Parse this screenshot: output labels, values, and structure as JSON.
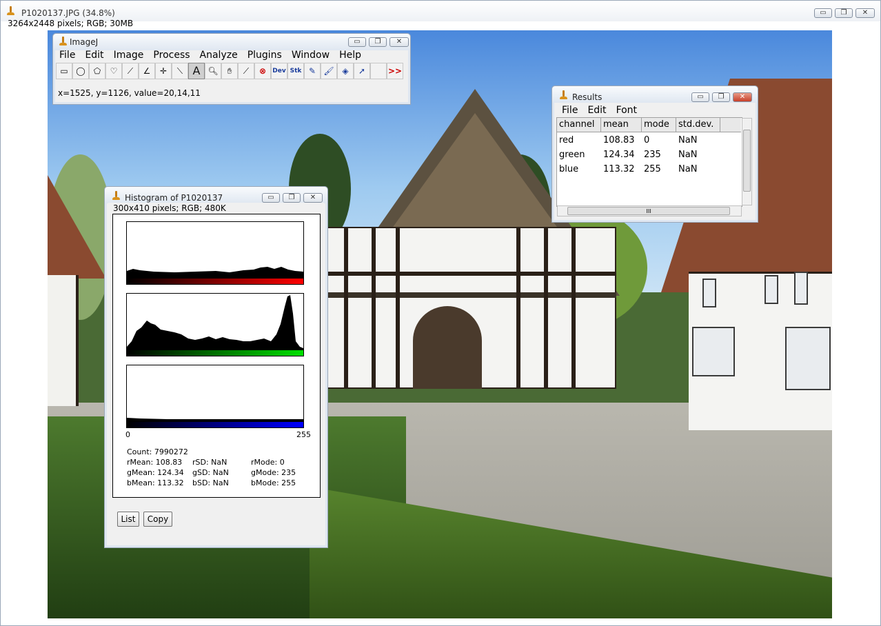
{
  "main_window": {
    "title": "P1020137.JPG (34.8%)",
    "info": "3264x2448 pixels; RGB; 30MB",
    "controls": {
      "minimize": "▭",
      "maximize": "❐",
      "close": "✕"
    }
  },
  "imagej": {
    "title": "ImageJ",
    "menu": [
      "File",
      "Edit",
      "Image",
      "Process",
      "Analyze",
      "Plugins",
      "Window",
      "Help"
    ],
    "tools": [
      {
        "name": "rectangle-tool-icon",
        "glyph": "▭"
      },
      {
        "name": "oval-tool-icon",
        "glyph": "◯"
      },
      {
        "name": "polygon-tool-icon",
        "glyph": "⬠"
      },
      {
        "name": "freehand-tool-icon",
        "glyph": "♡"
      },
      {
        "name": "line-tool-icon",
        "glyph": "⟋"
      },
      {
        "name": "angle-tool-icon",
        "glyph": "∠"
      },
      {
        "name": "point-tool-icon",
        "glyph": "✛"
      },
      {
        "name": "wand-tool-icon",
        "glyph": "⟍"
      },
      {
        "name": "text-tool-icon",
        "glyph": "A"
      },
      {
        "name": "magnifier-tool-icon",
        "glyph": "🔍︎"
      },
      {
        "name": "hand-tool-icon",
        "glyph": "✋︎"
      },
      {
        "name": "dropper-tool-icon",
        "glyph": "⟋"
      },
      {
        "name": "cancel-tool-icon",
        "glyph": "⊗"
      },
      {
        "name": "dev-tool-icon",
        "glyph": "Dev"
      },
      {
        "name": "stk-tool-icon",
        "glyph": "Stk"
      },
      {
        "name": "pencil-tool-icon",
        "glyph": "✎"
      },
      {
        "name": "brush-tool-icon",
        "glyph": "🖌︎"
      },
      {
        "name": "flood-fill-tool-icon",
        "glyph": "◈"
      },
      {
        "name": "arrow-tool-icon",
        "glyph": "➚"
      },
      {
        "name": "blank-tool-icon",
        "glyph": ""
      },
      {
        "name": "more-tools-icon",
        "glyph": ">>"
      }
    ],
    "status": "x=1525, y=1126, value=20,14,11"
  },
  "results": {
    "title": "Results",
    "menu": [
      "File",
      "Edit",
      "Font"
    ],
    "columns": [
      "channel",
      "mean",
      "mode",
      "std.dev."
    ],
    "rows": [
      [
        "red",
        "108.83",
        "0",
        "NaN"
      ],
      [
        "green",
        "124.34",
        "235",
        "NaN"
      ],
      [
        "blue",
        "113.32",
        "255",
        "NaN"
      ]
    ],
    "hscroll_grip": "III"
  },
  "histogram": {
    "title": "Histogram of P1020137",
    "info": "300x410 pixels; RGB; 480K",
    "axis_min": "0",
    "axis_max": "255",
    "count": "Count: 7990272",
    "stats": [
      [
        "rMean: 108.83",
        "rSD: NaN",
        "rMode: 0"
      ],
      [
        "gMean: 124.34",
        "gSD: NaN",
        "gMode: 235"
      ],
      [
        "bMean: 113.32",
        "bSD: NaN",
        "bMode: 255"
      ]
    ],
    "buttons": {
      "list": "List",
      "copy": "Copy"
    },
    "colors": {
      "red": "#ff0000",
      "green": "#00e000",
      "blue": "#0000ff"
    }
  }
}
